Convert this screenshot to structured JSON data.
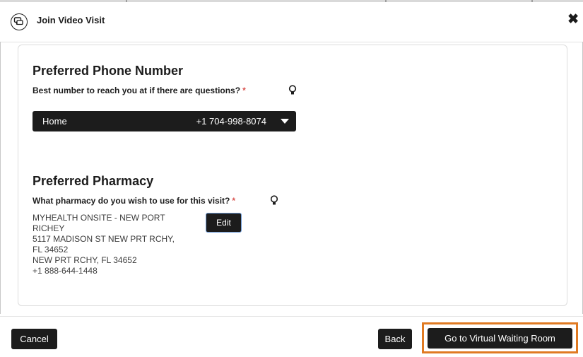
{
  "dialog": {
    "title": "Join Video Visit",
    "close_icon": "close-x-icon"
  },
  "phone": {
    "heading": "Preferred Phone Number",
    "question": "Best number to reach you at if there are questions?",
    "required_mark": "*",
    "selected_label": "Home",
    "selected_number": "+1 704-998-8074"
  },
  "pharmacy": {
    "heading": "Preferred Pharmacy",
    "question": "What pharmacy do you wish to use for this visit?",
    "required_mark": "*",
    "address_lines": [
      "MYHEALTH ONSITE - NEW PORT",
      "RICHEY",
      "5117 MADISON ST NEW PRT RCHY,",
      "FL 34652",
      "NEW PRT RCHY, FL 34652",
      "+1 888-644-1448"
    ],
    "edit_label": "Edit"
  },
  "footer": {
    "cancel_label": "Cancel",
    "back_label": "Back",
    "go_label": "Go to Virtual Waiting Room"
  },
  "colors": {
    "button_bg": "#1c1c1c",
    "highlight": "#e07a22",
    "required": "#d9534f"
  }
}
